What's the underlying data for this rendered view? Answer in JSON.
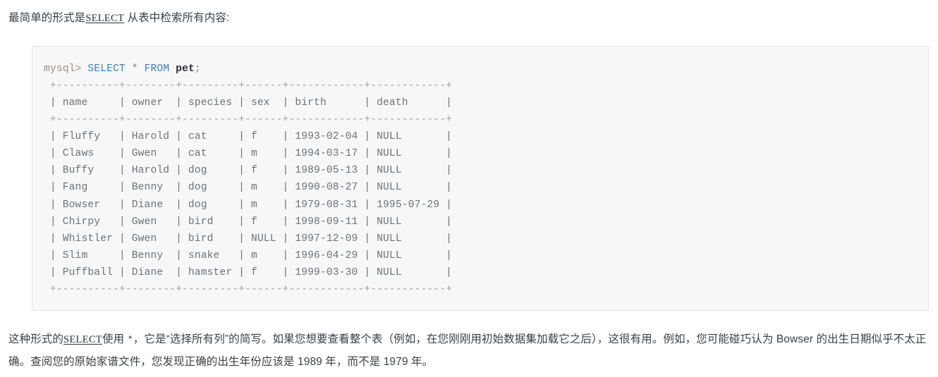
{
  "intro": {
    "before": "最简单的形式是",
    "code": "SELECT",
    "after": " 从表中检索所有内容:"
  },
  "code_block": {
    "prompt": "mysql>",
    "keyword_select": "SELECT",
    "star": "*",
    "keyword_from": "FROM",
    "table": "pet",
    "semicolon": ";",
    "separator": "+----------+--------+---------+------+------------+------------+",
    "header_row": "| name     | owner  | species | sex  | birth      | death      |",
    "columns": [
      "name",
      "owner",
      "species",
      "sex",
      "birth",
      "death"
    ],
    "rows": [
      {
        "name": "Fluffy",
        "owner": "Harold",
        "species": "cat",
        "sex": "f",
        "birth": "1993-02-04",
        "death": "NULL"
      },
      {
        "name": "Claws",
        "owner": "Gwen",
        "species": "cat",
        "sex": "m",
        "birth": "1994-03-17",
        "death": "NULL"
      },
      {
        "name": "Buffy",
        "owner": "Harold",
        "species": "dog",
        "sex": "f",
        "birth": "1989-05-13",
        "death": "NULL"
      },
      {
        "name": "Fang",
        "owner": "Benny",
        "species": "dog",
        "sex": "m",
        "birth": "1990-08-27",
        "death": "NULL"
      },
      {
        "name": "Bowser",
        "owner": "Diane",
        "species": "dog",
        "sex": "m",
        "birth": "1979-08-31",
        "death": "1995-07-29"
      },
      {
        "name": "Chirpy",
        "owner": "Gwen",
        "species": "bird",
        "sex": "f",
        "birth": "1998-09-11",
        "death": "NULL"
      },
      {
        "name": "Whistler",
        "owner": "Gwen",
        "species": "bird",
        "sex": "NULL",
        "birth": "1997-12-09",
        "death": "NULL"
      },
      {
        "name": "Slim",
        "owner": "Benny",
        "species": "snake",
        "sex": "m",
        "birth": "1996-04-29",
        "death": "NULL"
      },
      {
        "name": "Puffball",
        "owner": "Diane",
        "species": "hamster",
        "sex": "f",
        "birth": "1999-03-30",
        "death": "NULL"
      }
    ],
    "row_lines": [
      "| Fluffy   | Harold | cat     | f    | 1993-02-04 | NULL       |",
      "| Claws    | Gwen   | cat     | m    | 1994-03-17 | NULL       |",
      "| Buffy    | Harold | dog     | f    | 1989-05-13 | NULL       |",
      "| Fang     | Benny  | dog     | m    | 1990-08-27 | NULL       |",
      "| Bowser   | Diane  | dog     | m    | 1979-08-31 | 1995-07-29 |",
      "| Chirpy   | Gwen   | bird    | f    | 1998-09-11 | NULL       |",
      "| Whistler | Gwen   | bird    | NULL | 1997-12-09 | NULL       |",
      "| Slim     | Benny  | snake   | m    | 1996-04-29 | NULL       |",
      "| Puffball | Diane  | hamster | f    | 1999-03-30 | NULL       |"
    ]
  },
  "outro": {
    "part1": "这种形式的",
    "code": "SELECT",
    "part2": "使用 ",
    "star": "*",
    "part3": "，它是“选择所有列”的简写。如果您想要查看整个表（例如，在您刚刚用初始数据集加载它之后），这很有用。例如，您可能碰巧认为 Bowser 的出生日期似乎不太正确。查阅您的原始家谱文件，您发现正确的出生年份应该是 1989 年，而不是 1979 年。"
  },
  "colors": {
    "text": "#3b4045",
    "code_bg": "#f7f7f7",
    "code_border": "#e4e4e4",
    "keyword": "#3d7fbf",
    "prompt": "#9b8f83",
    "table_name": "#2b3034",
    "grid": "#9aa0a6",
    "cell": "#6c7278"
  }
}
